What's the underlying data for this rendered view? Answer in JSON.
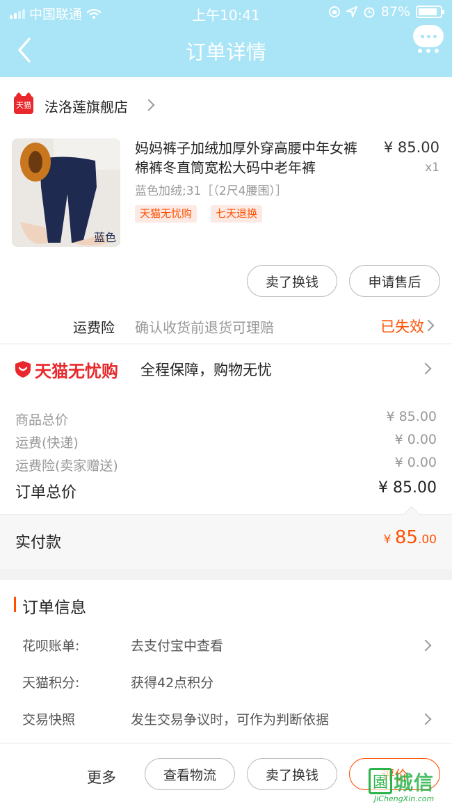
{
  "status_bar": {
    "carrier": "中国联通",
    "time": "上午10:41",
    "battery": "87%",
    "battery_level": 0.87
  },
  "nav": {
    "title": "订单详情"
  },
  "shop": {
    "badge": "天猫",
    "name": "法洛莲旗舰店"
  },
  "product": {
    "title": "妈妈裤子加绒加厚外穿高腰中年女裤棉裤冬直筒宽松大码中老年裤",
    "price": "¥ 85.00",
    "quantity": "x1",
    "sku": "蓝色加绒;31［（2尺4腰围）］",
    "thumb_label": "蓝色",
    "tags": [
      "天猫无忧购",
      "七天退换"
    ]
  },
  "item_actions": {
    "sell_button": "卖了换钱",
    "after_sale_button": "申请售后"
  },
  "shipping_insurance": {
    "label": "运费险",
    "description": "确认收货前退货可理赔",
    "status": "已失效"
  },
  "guarantee": {
    "brand": "天猫无忧购",
    "text": "全程保障，购物无忧"
  },
  "summary": {
    "rows": [
      {
        "label": "商品总价",
        "value": "¥ 85.00"
      },
      {
        "label": "运费(快递)",
        "value": "¥ 0.00"
      },
      {
        "label": "运费险(卖家赠送)",
        "value": "¥ 0.00"
      }
    ],
    "total_label": "订单总价",
    "total_value": "¥ 85.00",
    "paid_label": "实付款",
    "paid_currency": "¥ ",
    "paid_integer": "85",
    "paid_decimal": ".00"
  },
  "order_info": {
    "title": "订单信息",
    "rows": [
      {
        "key": "花呗账单:",
        "value": "去支付宝中查看"
      },
      {
        "key": "天猫积分:",
        "value": "获得42点积分"
      },
      {
        "key": "交易快照",
        "value": "发生交易争议时，可作为判断依据"
      }
    ]
  },
  "bottom_bar": {
    "more": "更多",
    "logistics": "查看物流",
    "sell": "卖了换钱",
    "review": "评价"
  },
  "watermark": {
    "text": "城信",
    "url": "JiChengXin.com"
  },
  "colors": {
    "header": "#a9e4f7",
    "accent": "#ff5000",
    "tmall_red": "#e8282c"
  }
}
